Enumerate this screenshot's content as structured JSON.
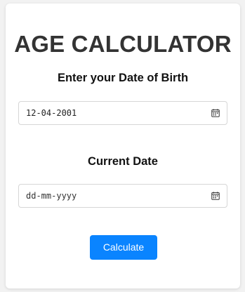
{
  "app": {
    "title": "AGE CALCULATOR"
  },
  "dob": {
    "label": "Enter your Date of Birth",
    "value": "12-04-2001",
    "icon": "calendar-icon"
  },
  "current": {
    "label": "Current Date",
    "placeholder": "dd-mm-yyyy",
    "icon": "calendar-icon"
  },
  "actions": {
    "calculate_label": "Calculate"
  },
  "colors": {
    "accent": "#0a84ff",
    "title": "#333333",
    "card": "#ffffff",
    "background": "#f2f2f2"
  }
}
